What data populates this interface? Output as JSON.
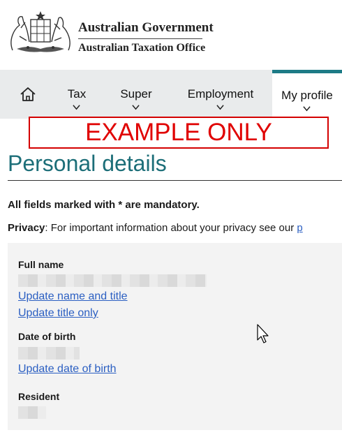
{
  "header": {
    "gov_title": "Australian Government",
    "agency": "Australian Taxation Office"
  },
  "nav": {
    "items": [
      {
        "id": "home",
        "label": "",
        "icon": "home-icon"
      },
      {
        "id": "tax",
        "label": "Tax"
      },
      {
        "id": "super",
        "label": "Super"
      },
      {
        "id": "employment",
        "label": "Employment"
      },
      {
        "id": "profile",
        "label": "My profile",
        "active": true
      }
    ]
  },
  "banner": {
    "text": "EXAMPLE ONLY",
    "color": "#e00000"
  },
  "page": {
    "title": "Personal details",
    "mandatory_note": "All fields marked with * are mandatory.",
    "privacy_label": "Privacy",
    "privacy_text": ": For important information about your privacy see our ",
    "privacy_link": "p"
  },
  "details": {
    "full_name_label": "Full name",
    "update_name_link": "Update name and title",
    "update_title_link": "Update title only",
    "dob_label": "Date of birth",
    "update_dob_link": "Update date of birth",
    "resident_label": "Resident"
  },
  "colors": {
    "accent": "#1c6e78",
    "nav_bg": "#e9ebec",
    "link": "#2b5fc2",
    "active_tab": "#1d7b86"
  }
}
